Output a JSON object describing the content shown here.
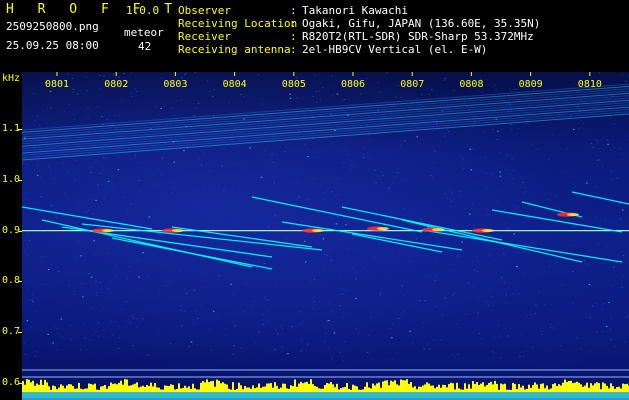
{
  "app": {
    "title": "H R O F F T",
    "version": "1.0.0"
  },
  "file": {
    "name": "2509250800.png",
    "datetime": "25.09.25 08:00"
  },
  "meteor": {
    "label": "meteor",
    "count": "42"
  },
  "info": [
    {
      "label": "Observer",
      "value": "Takanori Kawachi"
    },
    {
      "label": "Receiving Location",
      "value": "Ogaki, Gifu, JAPAN (136.60E, 35.35N)"
    },
    {
      "label": "Receiver",
      "value": "R820T2(RTL-SDR) SDR-Sharp 53.372MHz"
    },
    {
      "label": "Receiving antenna",
      "value": "2el-HB9CV Vertical (el. E-W)"
    }
  ],
  "chart_data": {
    "type": "heatmap",
    "ylabel": "kHz",
    "yticks": [
      "1.1",
      "1.0",
      "0.9",
      "0.8",
      "0.7",
      "0.6"
    ],
    "xticks": [
      "0801",
      "0802",
      "0803",
      "0804",
      "0805",
      "0806",
      "0807",
      "0808",
      "0809",
      "0810"
    ],
    "colors": {
      "background": "#0a1a7a",
      "signal": "#00ffff",
      "hot": "#ff3030",
      "axis": "#ffff00"
    }
  }
}
